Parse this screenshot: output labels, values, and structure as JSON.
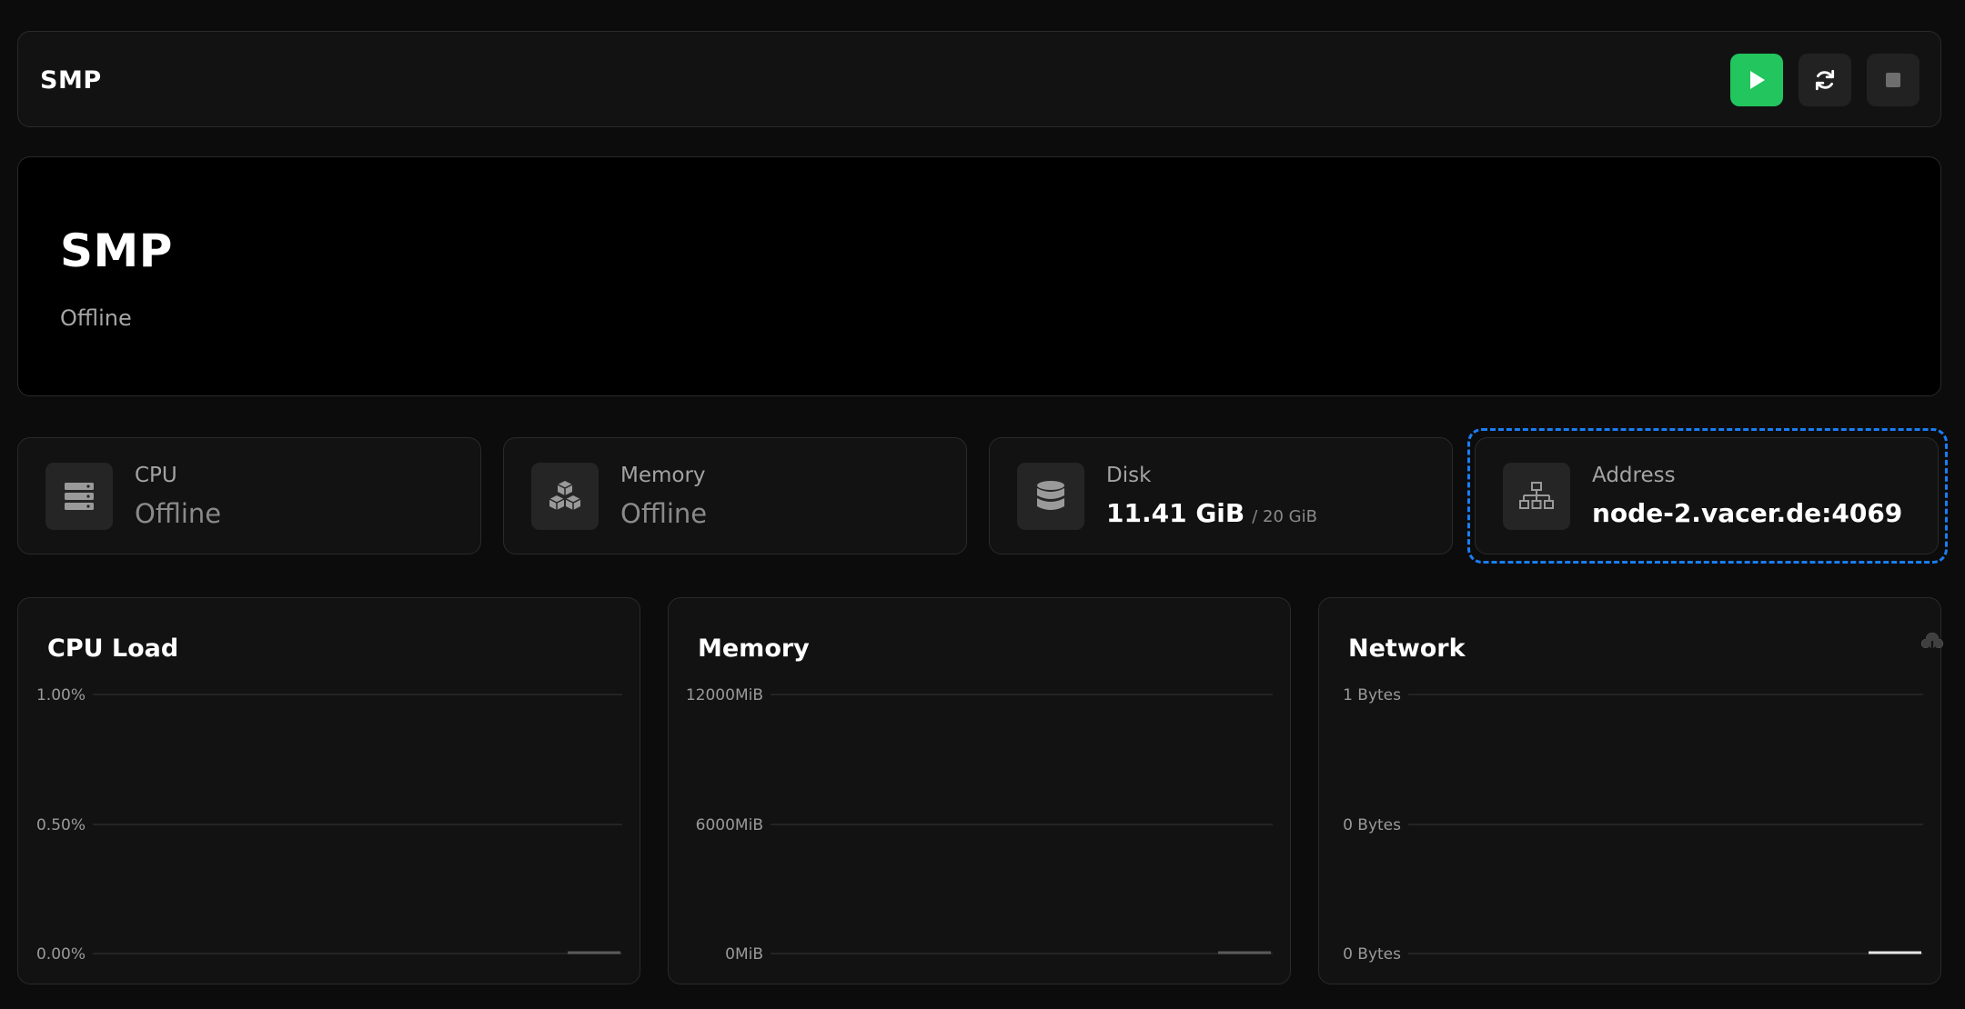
{
  "header": {
    "title": "SMP",
    "controls": [
      {
        "name": "start",
        "icon": "play-icon",
        "color": "#22c55e"
      },
      {
        "name": "restart",
        "icon": "refresh-icon"
      },
      {
        "name": "stop",
        "icon": "stop-icon"
      }
    ]
  },
  "server": {
    "name": "SMP",
    "status": "Offline"
  },
  "stats": {
    "cpu": {
      "label": "CPU",
      "value": "Offline",
      "icon": "server-icon"
    },
    "memory": {
      "label": "Memory",
      "value": "Offline",
      "icon": "cubes-icon"
    },
    "disk": {
      "label": "Disk",
      "value": "11.41 GiB",
      "limit": "/ 20 GiB",
      "icon": "database-icon"
    },
    "address": {
      "label": "Address",
      "value": "node-2.vacer.de:4069",
      "icon": "network-icon",
      "focus_color": "#1a7ef2"
    }
  },
  "charts": {
    "cpu": {
      "title": "CPU Load"
    },
    "memory": {
      "title": "Memory"
    },
    "network": {
      "title": "Network",
      "icons": [
        "upload-cloud-icon",
        "download-cloud-icon"
      ]
    }
  },
  "chart_data": [
    {
      "type": "line",
      "title": "CPU Load",
      "yticks": [
        "1.00%",
        "0.50%",
        "0.00%"
      ],
      "ylim": [
        0,
        1
      ],
      "series": [
        {
          "values": [
            0,
            0,
            0,
            0
          ]
        }
      ]
    },
    {
      "type": "line",
      "title": "Memory",
      "yticks": [
        "12000MiB",
        "6000MiB",
        "0MiB"
      ],
      "ylim": [
        0,
        12000
      ],
      "series": [
        {
          "values": [
            0,
            0,
            0,
            0
          ]
        }
      ]
    },
    {
      "type": "line",
      "title": "Network",
      "yticks": [
        "1 Bytes",
        "0 Bytes",
        "0 Bytes"
      ],
      "ylim": [
        0,
        1
      ],
      "series": [
        {
          "values": [
            0,
            0,
            0,
            0
          ]
        }
      ]
    }
  ]
}
